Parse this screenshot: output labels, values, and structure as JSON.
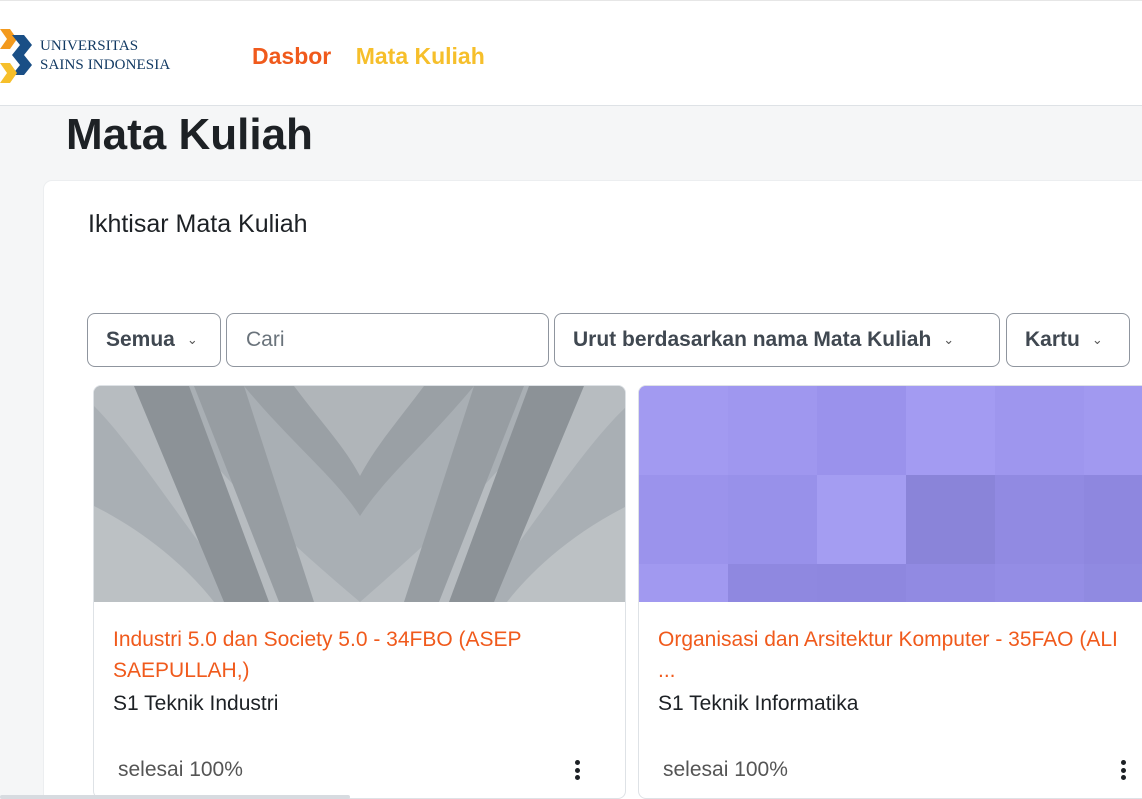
{
  "header": {
    "logo_line1": "UNIVERSITAS",
    "logo_line2": "SAINS INDONESIA",
    "nav": [
      {
        "label": "Dasbor",
        "color": "#f05a1c"
      },
      {
        "label": "Mata Kuliah",
        "color": "#f6bf2b"
      }
    ]
  },
  "page": {
    "title": "Mata Kuliah",
    "block_title": "Ikhtisar Mata Kuliah"
  },
  "filters": {
    "grouping": "Semua",
    "search_placeholder": "Cari",
    "sort": "Urut berdasarkan nama Mata Kuliah",
    "view": "Kartu"
  },
  "courses": [
    {
      "name": "Industri 5.0 dan Society 5.0 - 34FBO (ASEP SAEPULLAH,)",
      "category": "S1 Teknik Industri",
      "progress": "selesai 100%"
    },
    {
      "name": "Organisasi dan Arsitektur Komputer - 35FAO (ALI ...",
      "category": "S1 Teknik Informatika",
      "progress": "selesai 100%"
    }
  ],
  "colors": {
    "accent_orange": "#f05a1c",
    "accent_yellow": "#f6bf2b",
    "brand_blue": "#123a63"
  }
}
